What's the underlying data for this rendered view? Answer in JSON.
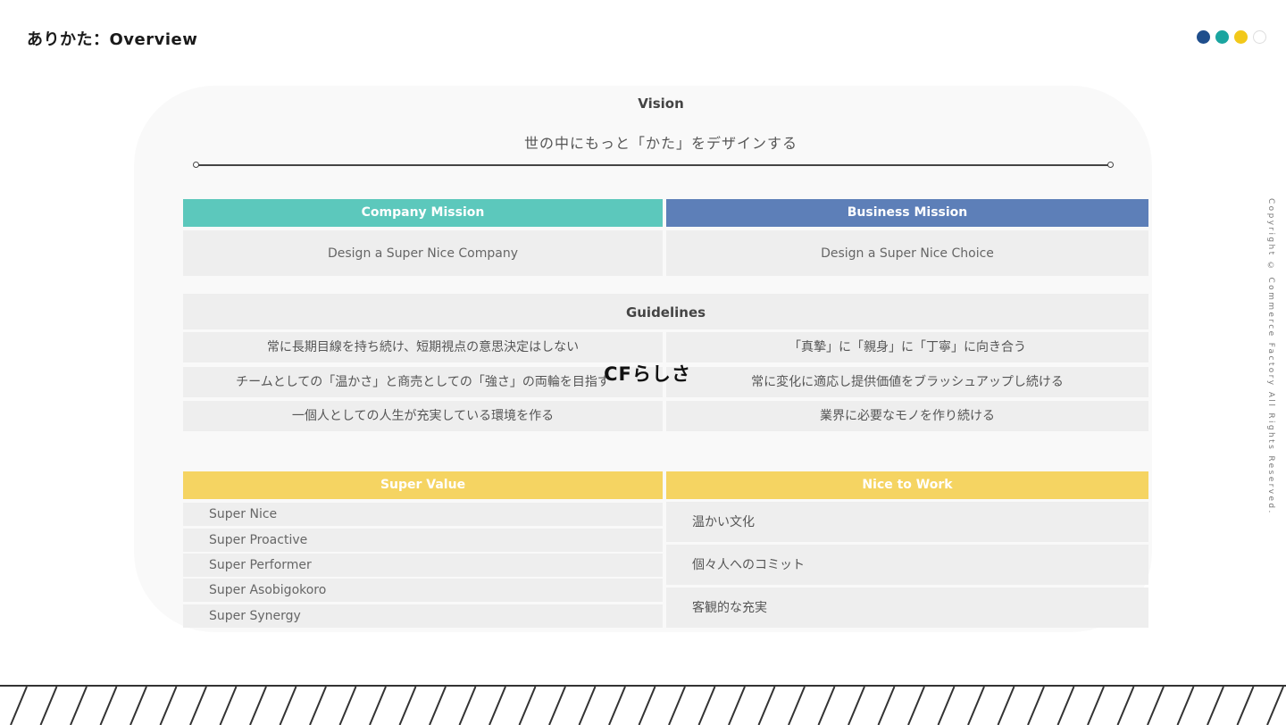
{
  "header": {
    "title": "ありかた：Overview",
    "dots": [
      "#1f4e8c",
      "#1aa5a0",
      "#f2c81a",
      "#ffffff"
    ]
  },
  "copyright": "Copyright © Commerce Factory All Rights Reserved.",
  "vision": {
    "label": "Vision",
    "text": "世の中にもっと「かた」をデザインする"
  },
  "missions": {
    "company": {
      "label": "Company Mission",
      "text": "Design a Super Nice Company",
      "color": "#5cc8bc"
    },
    "business": {
      "label": "Business Mission",
      "text": "Design a Super Nice Choice",
      "color": "#5d7fb8"
    }
  },
  "guidelines": {
    "label": "Guidelines",
    "overlay_label": "CFらしさ",
    "left": [
      "常に長期目線を持ち続け、短期視点の意思決定はしない",
      "チームとしての「温かさ」と商売としての「強さ」の両輪を目指す",
      "一個人としての人生が充実している環境を作る"
    ],
    "right": [
      "「真摯」に「親身」に「丁寧」に向き合う",
      "常に変化に適応し提供価値をブラッシュアップし続ける",
      "業界に必要なモノを作り続ける"
    ]
  },
  "super_value": {
    "label": "Super Value",
    "color": "#f5d462",
    "items": [
      "Super Nice",
      "Super Proactive",
      "Super Performer",
      "Super Asobigokoro",
      "Super Synergy"
    ]
  },
  "nice_to_work": {
    "label": "Nice to Work",
    "color": "#f5d462",
    "items": [
      "温かい文化",
      "個々人へのコミット",
      "客観的な充実"
    ]
  }
}
